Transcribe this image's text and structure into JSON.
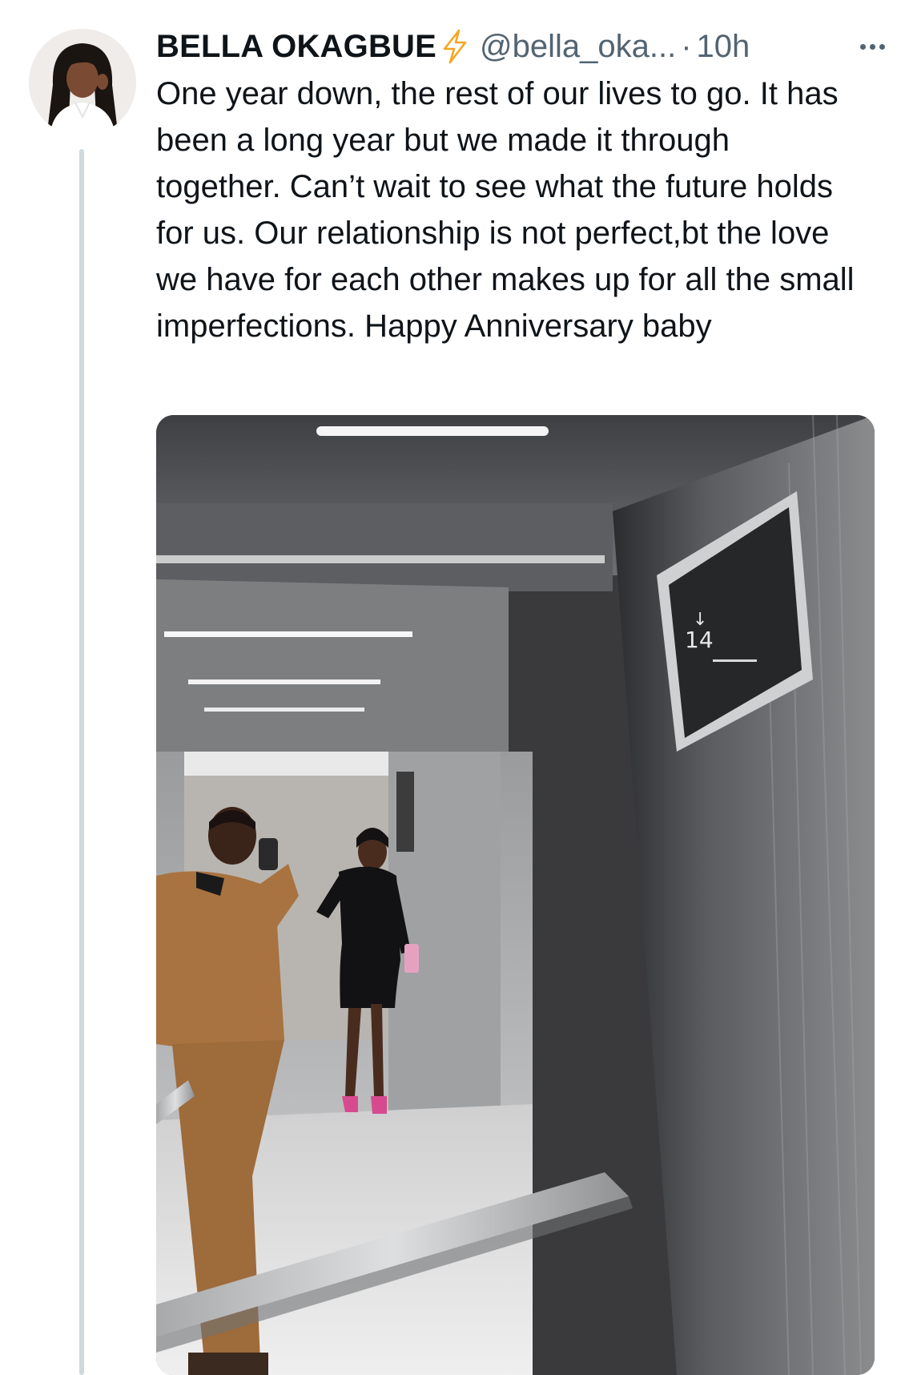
{
  "tweet": {
    "display_name": "BELLA OKAGBUE",
    "handle": "@bella_oka...",
    "separator": "·",
    "time": "10h",
    "text": "One year down, the rest of our lives to go. It has been a long year but we made it through together. Can’t wait to see what the future holds for us. Our relationship is not perfect,bt the love we have for each other makes up for all the small imperfections. Happy Anniversary baby",
    "badge_icon": "lightning-bolt-icon",
    "more_icon": "more-horizontal-icon",
    "photo": {
      "floor_display": "14",
      "floor_arrow": "↓"
    }
  },
  "colors": {
    "text_primary": "#0f1419",
    "text_secondary": "#536471",
    "badge": "#f5a623",
    "thread_line": "#cfd9de"
  }
}
